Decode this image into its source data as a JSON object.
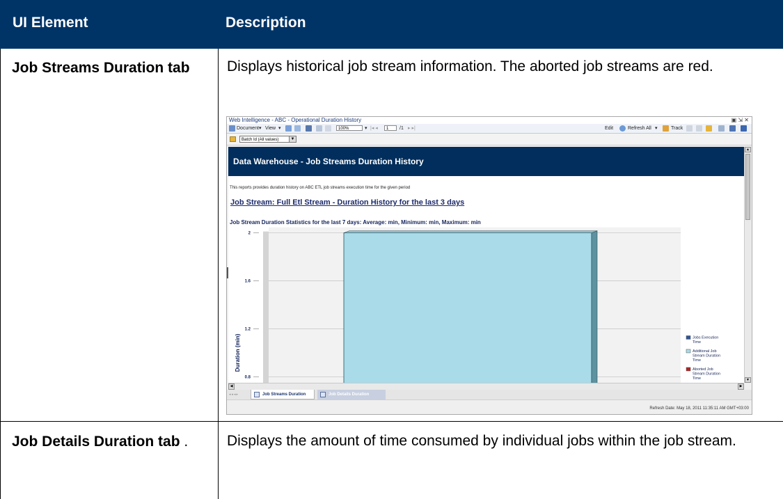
{
  "table": {
    "header": {
      "col1": "UI Element",
      "col2": "Description"
    },
    "rows": [
      {
        "element": "Job Streams Duration tab",
        "description": "Displays historical job stream information. The aborted job streams are red."
      },
      {
        "element": "Job Details Duration tab",
        "element_suffix": ".",
        "description": "Displays the amount of time consumed by individual jobs within the job stream."
      }
    ]
  },
  "screenshot": {
    "window_title": "Web Intelligence - ABC - Operational Duration History",
    "toolbar": {
      "document_menu": "Document",
      "view_menu": "View",
      "zoom": "100%",
      "page_current": "1",
      "page_total": "/1",
      "edit": "Edit",
      "refresh_all": "Refresh All",
      "track": "Track"
    },
    "filter": {
      "value": "Batch Id (All values)"
    },
    "report": {
      "banner_title": "Data Warehouse - Job Streams Duration History",
      "note": "This reports provides duration history on ABC ETL job streams execution time for the given period",
      "subtitle": "Job Stream: Full Etl Stream - Duration History for the last 3 days",
      "stats": "Job Stream Duration Statistics for the last 7 days: Average:  min, Minimum:  min, Maximum:  min"
    },
    "tabs": [
      {
        "label": "Job Streams Duration",
        "active": true
      },
      {
        "label": "Job Details Duration",
        "active": false
      }
    ],
    "status": "Refresh Date: May 18, 2011 11:35:11 AM GMT+03:00"
  },
  "chart_data": {
    "type": "bar",
    "ylabel": "Duration (min)",
    "yticks": [
      "2",
      "1.6",
      "1.2",
      "0.8"
    ],
    "ylim": [
      0.8,
      2
    ],
    "visible_range": [
      0.75,
      2.05
    ],
    "series": [
      {
        "name": "Jobs Execution Time",
        "color": "#2f5597",
        "values": [
          0
        ]
      },
      {
        "name": "Additional Job Stream Duration Time",
        "color": "#a9dbe9",
        "values": [
          2
        ]
      },
      {
        "name": "Aborted Job Stream Duration Time",
        "color": "#b22222",
        "values": [
          0
        ]
      }
    ],
    "legend": "right",
    "grid": true
  }
}
